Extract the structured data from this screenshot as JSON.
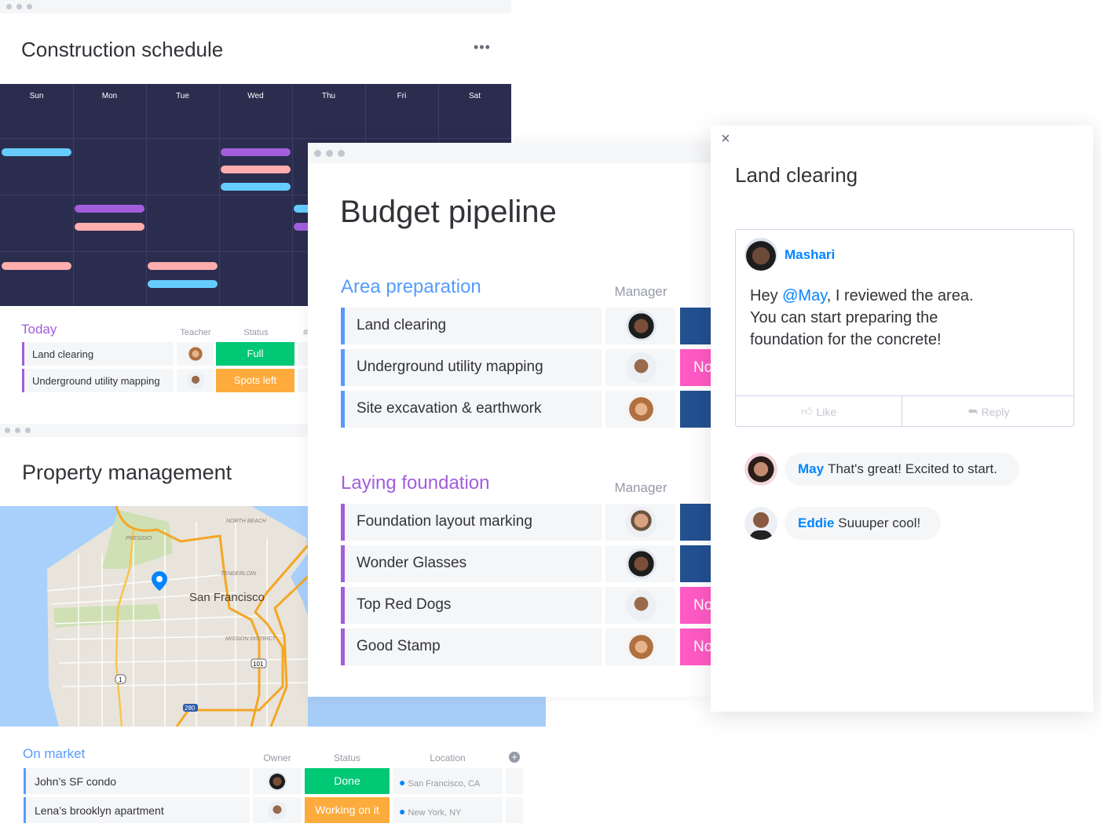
{
  "construction": {
    "title": "Construction schedule",
    "more_icon": "more-horizontal-icon",
    "days": [
      "Sun",
      "Mon",
      "Tue",
      "Wed",
      "Thu",
      "Fri",
      "Sat"
    ],
    "colors": {
      "blue": "#66ccff",
      "purple": "#a25ddc",
      "pink": "#ffadad",
      "calendar_bg": "#2b2d4f"
    },
    "today": {
      "group": "Today",
      "columns": [
        "Teacher",
        "Status",
        "#"
      ],
      "rows": [
        {
          "name": "Land clearing",
          "status": "Full",
          "status_color": "#00c875"
        },
        {
          "name": "Underground utility mapping",
          "status": "Spots left",
          "status_color": "#fdab3d"
        }
      ]
    }
  },
  "property": {
    "title": "Property management",
    "map": {
      "city": "San Francisco",
      "labels": [
        "NORTH BEACH",
        "PRESIDIO",
        "TENDERLOIN",
        "MISSION DISTRICT"
      ],
      "shields": [
        "1",
        "101",
        "280"
      ]
    },
    "group": "On market",
    "columns": [
      "Owner",
      "Status",
      "Location"
    ],
    "rows": [
      {
        "name": "John’s SF condo",
        "status": "Done",
        "status_color": "#00c875",
        "location": "San Francisco, CA"
      },
      {
        "name": "Lena’s brooklyn apartment",
        "status": "Working on it",
        "status_color": "#fdab3d",
        "location": "New York, NY"
      }
    ]
  },
  "budget": {
    "title": "Budget pipeline",
    "groups": [
      {
        "name": "Area preparation",
        "color": "#579bfc",
        "column": "Manager",
        "rows": [
          {
            "name": "Land clearing",
            "status": "",
            "status_color": "#225091"
          },
          {
            "name": "Underground utility mapping",
            "status": "No",
            "status_color": "#ff5ac4"
          },
          {
            "name": "Site excavation & earthwork",
            "status": "",
            "status_color": "#225091"
          }
        ]
      },
      {
        "name": "Laying foundation",
        "color": "#a25ddc",
        "column": "Manager",
        "rows": [
          {
            "name": "Foundation layout marking",
            "status": "",
            "status_color": "#225091"
          },
          {
            "name": "Wonder Glasses",
            "status": "",
            "status_color": "#225091"
          },
          {
            "name": "Top Red Dogs",
            "status": "No",
            "status_color": "#ff5ac4"
          },
          {
            "name": "Good Stamp",
            "status": "No",
            "status_color": "#ff5ac4"
          }
        ]
      }
    ]
  },
  "updates": {
    "title": "Land clearing",
    "close_icon": "close-icon",
    "post": {
      "author": "Mashari",
      "text_before": "Hey ",
      "mention": "@May",
      "line1_after": ", I reviewed the area.",
      "line2": "You can start preparing the",
      "line3": "foundation for the concrete!",
      "like": "Like",
      "reply": "Reply"
    },
    "replies": [
      {
        "author": "May",
        "text": "That's great! Excited to start."
      },
      {
        "author": "Eddie",
        "text": "Suuuper cool!"
      }
    ],
    "accent": "#0085ff"
  }
}
